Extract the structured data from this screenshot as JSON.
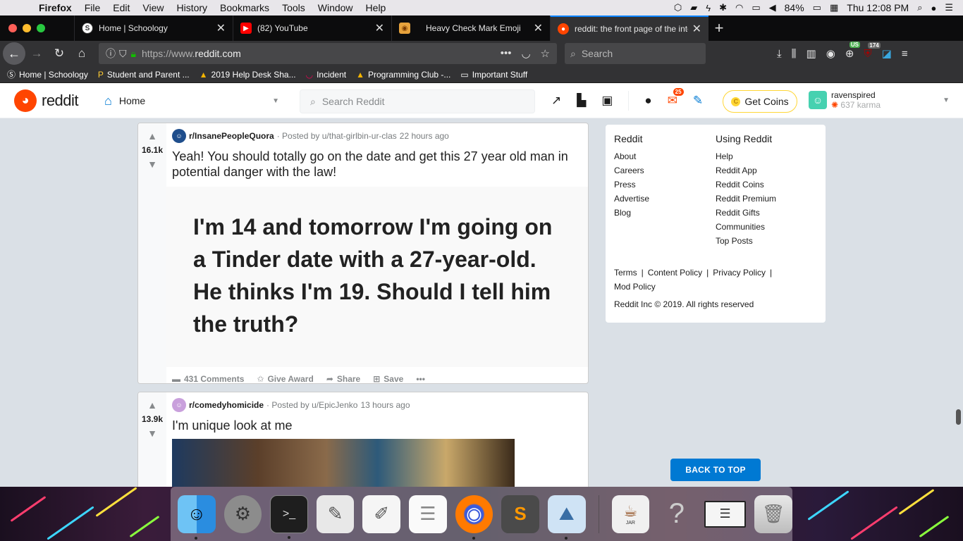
{
  "menubar": {
    "items": [
      "Firefox",
      "File",
      "Edit",
      "View",
      "History",
      "Bookmarks",
      "Tools",
      "Window",
      "Help"
    ],
    "battery": "84%",
    "clock": "Thu 12:08 PM"
  },
  "tabs": [
    {
      "label": "Home | Schoology",
      "favicon": "schoology-icon",
      "active": false
    },
    {
      "label": "(82) YouTube",
      "favicon": "youtube-icon",
      "active": false
    },
    {
      "label": "Heavy Check Mark Emoji",
      "favicon": "emojipedia-icon",
      "active": false
    },
    {
      "label": "reddit: the front page of the inte",
      "favicon": "reddit-icon",
      "active": true
    }
  ],
  "navbar": {
    "url_prefix": "https://www.",
    "url_domain": "reddit.com",
    "search_placeholder": "Search",
    "ext_badge_1": "US",
    "ext_badge_2": "174"
  },
  "bookmarks": [
    {
      "label": "Home | Schoology",
      "icon": "schoology-icon"
    },
    {
      "label": "Student and Parent ...",
      "icon": "powerschool-icon"
    },
    {
      "label": "2019 Help Desk Sha...",
      "icon": "drive-icon"
    },
    {
      "label": "Incident",
      "icon": "servicenow-icon"
    },
    {
      "label": "Programming Club -...",
      "icon": "drive-icon"
    },
    {
      "label": "Important Stuff",
      "icon": "folder-icon"
    }
  ],
  "reddit_header": {
    "logo_text": "reddit",
    "home_label": "Home",
    "search_placeholder": "Search Reddit",
    "mail_count": "25",
    "get_coins": "Get Coins",
    "username": "ravenspired",
    "karma": "637 karma"
  },
  "posts": [
    {
      "score": "16.1k",
      "subreddit": "r/InsanePeopleQuora",
      "posted_by": "· Posted by u/that-girlbin-ur-clas",
      "time": "22 hours ago",
      "title": "Yeah! You should totally go on the date and get this 27 year old man in potential danger with the law!",
      "image_text": "I'm 14 and tomorrow I'm going on a Tinder date with a 27-year-old. He thinks I'm 19. Should I tell him the truth?",
      "comments": "431 Comments",
      "award": "Give Award",
      "share": "Share",
      "save": "Save"
    },
    {
      "score": "13.9k",
      "subreddit": "r/comedyhomicide",
      "posted_by": "· Posted by u/EpicJenko",
      "time": "13 hours ago",
      "title": "I'm unique look at me"
    }
  ],
  "sidebar": {
    "col1_title": "Reddit",
    "col1_links": [
      "About",
      "Careers",
      "Press",
      "Advertise",
      "Blog"
    ],
    "col2_title": "Using Reddit",
    "col2_links": [
      "Help",
      "Reddit App",
      "Reddit Coins",
      "Reddit Premium",
      "Reddit Gifts",
      "Communities",
      "Top Posts"
    ],
    "legal_links": [
      "Terms",
      "Content Policy",
      "Privacy Policy",
      "Mod Policy"
    ],
    "copyright": "Reddit Inc © 2019. All rights reserved"
  },
  "back_to_top": "BACK TO TOP",
  "colors": {
    "reddit_orange": "#ff4500",
    "reddit_blue": "#0079d3",
    "firefox_blue": "#0a84ff"
  },
  "dock": [
    "finder-icon",
    "system-preferences-icon",
    "terminal-icon",
    "script-editor-icon",
    "textedit-icon",
    "notes-icon",
    "firefox-icon",
    "sublime-text-icon",
    "preview-icon",
    "jar-launcher-icon",
    "unknown-app-icon",
    "screenshot-icon",
    "trash-icon"
  ],
  "dock_jar_label": "JAR"
}
